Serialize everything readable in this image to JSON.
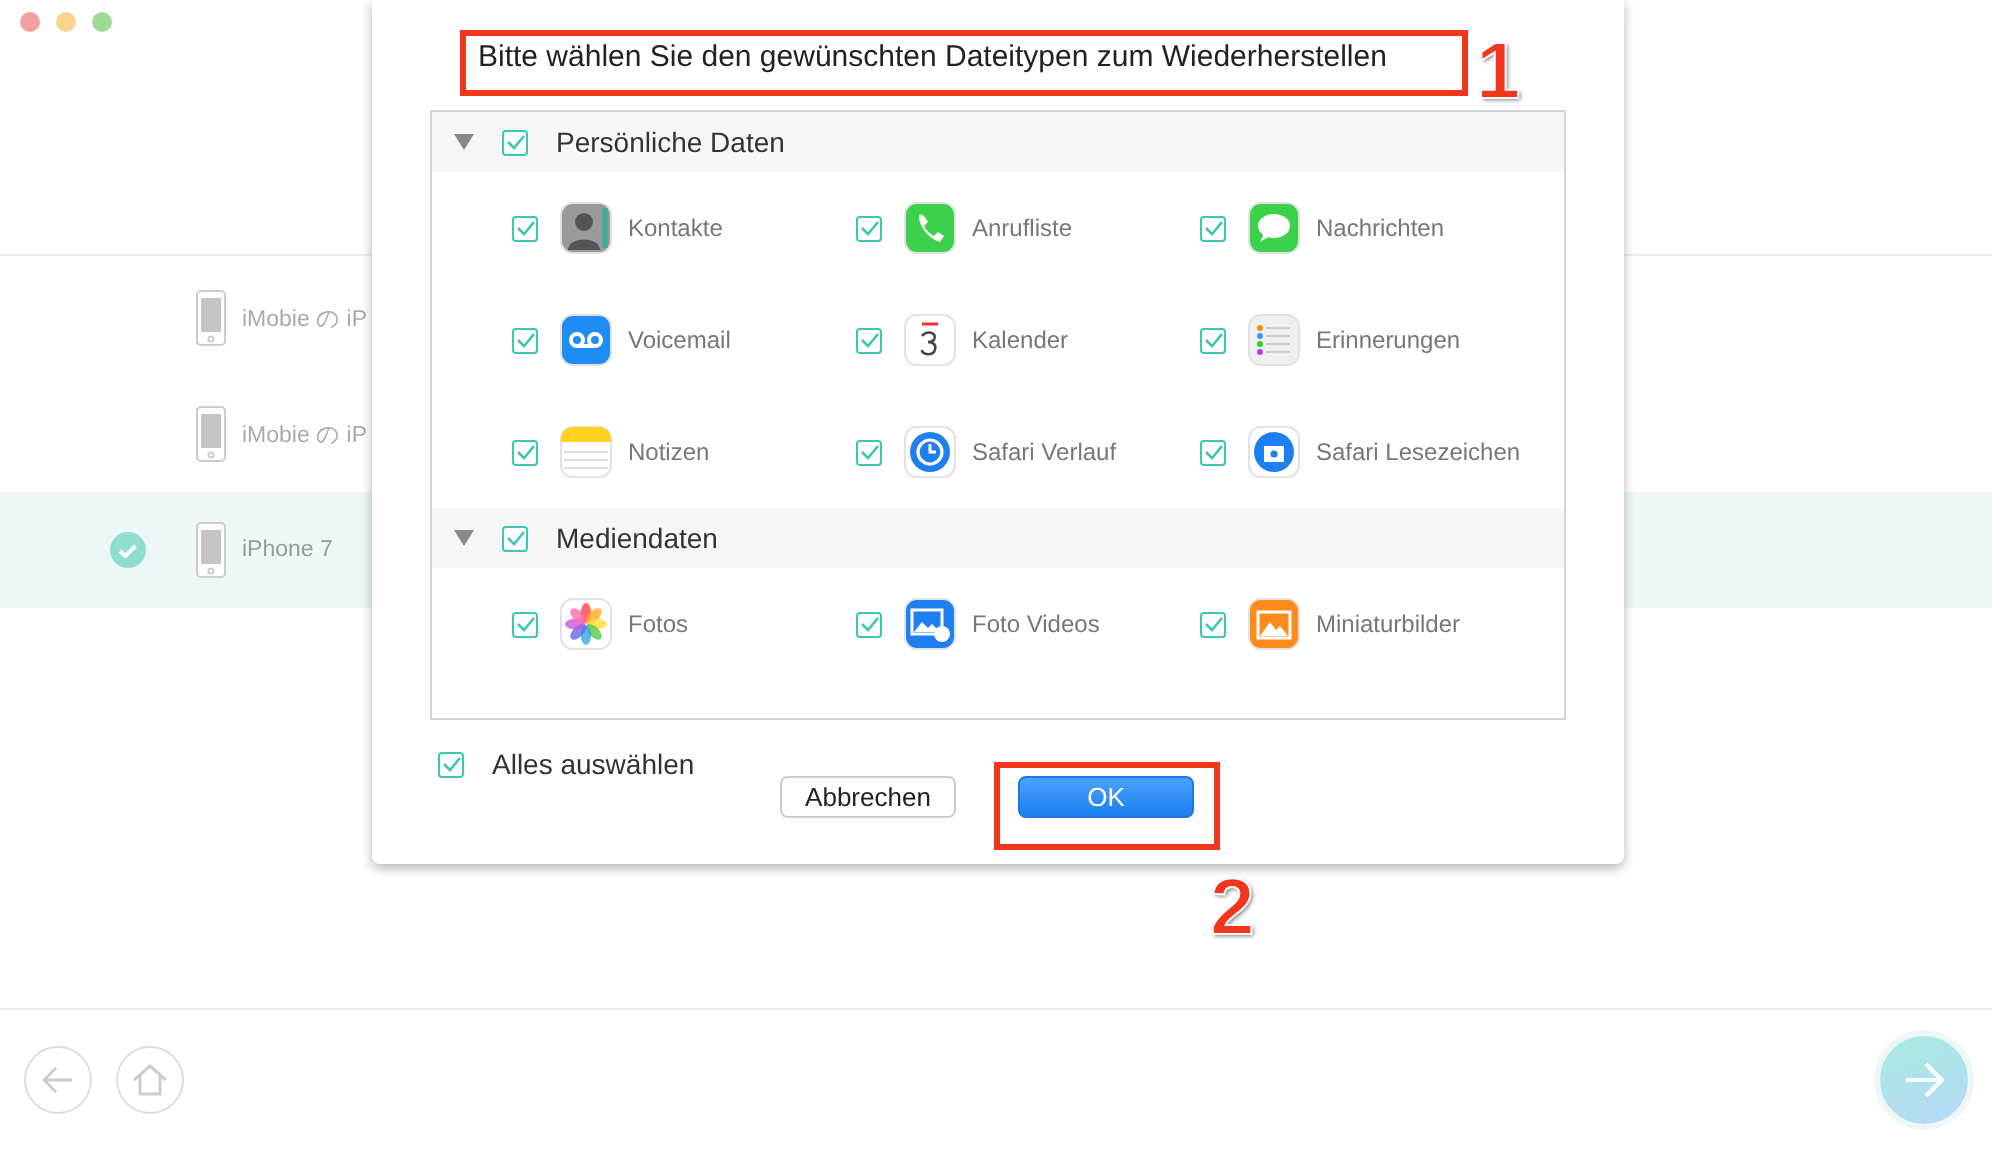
{
  "devices": [
    {
      "name": "iMobie の iP",
      "selected": false
    },
    {
      "name": "iMobie の iP",
      "selected": false
    },
    {
      "name": "iPhone 7",
      "selected": true
    }
  ],
  "dialog": {
    "title": "Bitte wählen Sie den gewünschten Dateitypen zum Wiederherstellen",
    "groups": [
      {
        "label": "Persönliche Daten",
        "checked": true,
        "expanded": true,
        "items": [
          {
            "label": "Kontakte",
            "checked": true
          },
          {
            "label": "Anrufliste",
            "checked": true
          },
          {
            "label": "Nachrichten",
            "checked": true
          },
          {
            "label": "Voicemail",
            "checked": true
          },
          {
            "label": "Kalender",
            "checked": true
          },
          {
            "label": "Erinnerungen",
            "checked": true
          },
          {
            "label": "Notizen",
            "checked": true
          },
          {
            "label": "Safari Verlauf",
            "checked": true
          },
          {
            "label": "Safari Lesezeichen",
            "checked": true
          }
        ]
      },
      {
        "label": "Mediendaten",
        "checked": true,
        "expanded": true,
        "items": [
          {
            "label": "Fotos",
            "checked": true
          },
          {
            "label": "Foto Videos",
            "checked": true
          },
          {
            "label": "Miniaturbilder",
            "checked": true
          }
        ]
      }
    ],
    "select_all": {
      "label": "Alles auswählen",
      "checked": true
    },
    "buttons": [
      {
        "label": "Abbrechen",
        "kind": "secondary"
      },
      {
        "label": "OK",
        "kind": "primary"
      }
    ]
  },
  "annotations": [
    "1",
    "2"
  ]
}
